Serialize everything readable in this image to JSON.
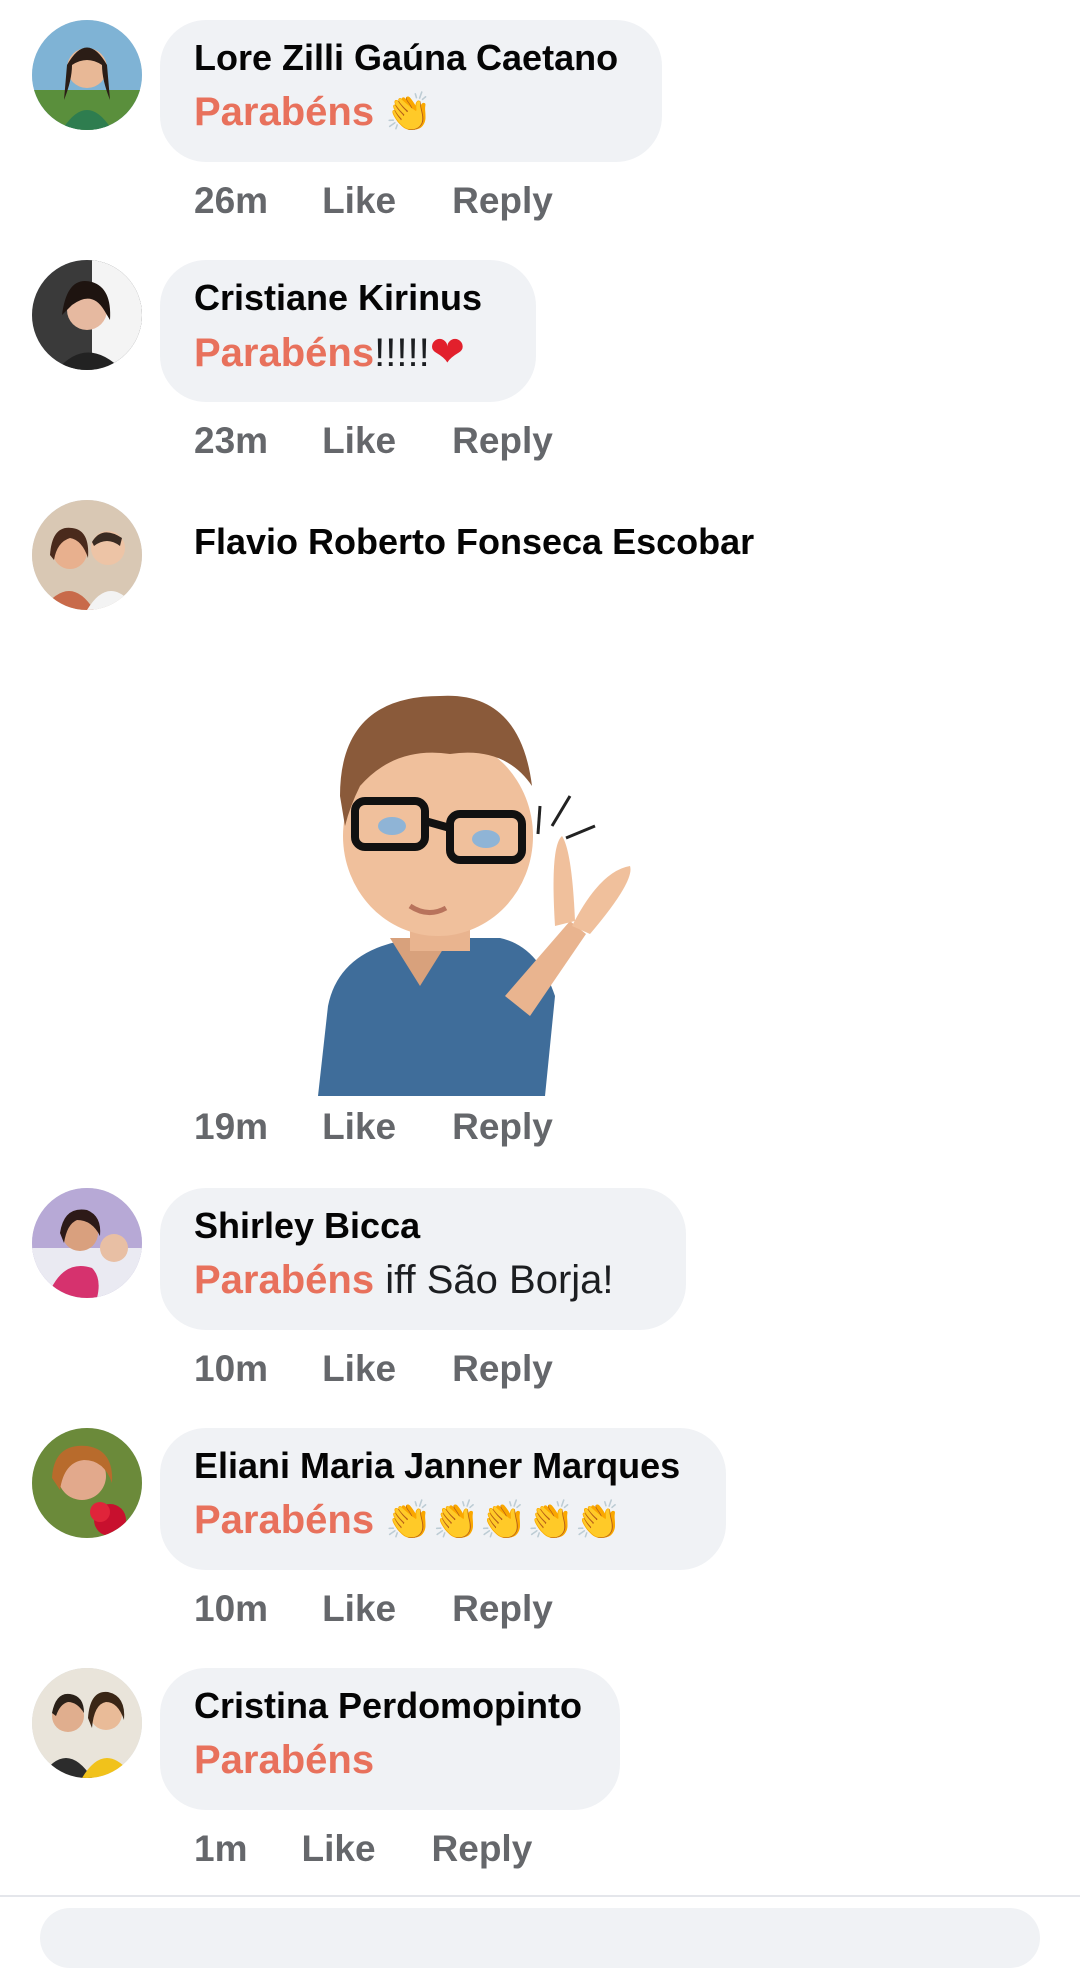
{
  "comments": [
    {
      "name": "Lore Zilli Gaúna Caetano",
      "highlight": "Parabéns",
      "rest": "",
      "emoji": "👏",
      "time": "26m",
      "like": "Like",
      "reply": "Reply"
    },
    {
      "name": "Cristiane Kirinus",
      "highlight": "Parabéns",
      "rest": "!!!!!",
      "emoji": "❤",
      "time": "23m",
      "like": "Like",
      "reply": "Reply"
    },
    {
      "name": "Flavio Roberto Fonseca Escobar",
      "time": "19m",
      "like": "Like",
      "reply": "Reply",
      "sticker": "avatar-clapping-sticker"
    },
    {
      "name": "Shirley Bicca",
      "highlight": "Parabéns",
      "rest": " iff São Borja!",
      "time": "10m",
      "like": "Like",
      "reply": "Reply"
    },
    {
      "name": "Eliani Maria Janner Marques",
      "highlight": "Parabéns",
      "rest": "",
      "emoji": "👏👏👏👏👏",
      "time": "10m",
      "like": "Like",
      "reply": "Reply"
    },
    {
      "name": "Cristina Perdomopinto",
      "highlight": "Parabéns",
      "rest": "",
      "time": "1m",
      "like": "Like",
      "reply": "Reply"
    }
  ],
  "colors": {
    "highlight": "#e8715c",
    "meta": "#65676b",
    "bubble": "#f0f2f5"
  }
}
